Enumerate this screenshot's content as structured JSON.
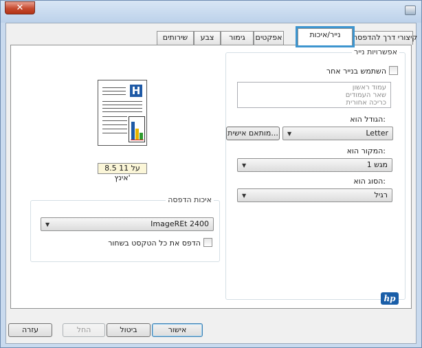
{
  "window": {
    "title": "",
    "close_label": "✕"
  },
  "tabs": [
    {
      "label": "קיצורי דרך להדפסה"
    },
    {
      "label": "נייר/איכות"
    },
    {
      "label": "אפקטים"
    },
    {
      "label": "גימור"
    },
    {
      "label": "צבע"
    },
    {
      "label": "שירותים"
    }
  ],
  "paper_options": {
    "legend": "אפשרויות נייר",
    "use_different_paper": "השתמש בנייר אחר",
    "page_list": [
      "עמוד ראשון",
      "שאר העמודים",
      "כריכה אחורית"
    ],
    "paper_size_label": "הגודל הוא:",
    "paper_size_value": "Letter",
    "custom_button": "מותאם אישית...",
    "paper_source_label": "המקור הוא:",
    "paper_source_value": "מגש 1",
    "paper_type_label": "הסוג הוא:",
    "paper_type_value": "רגיל"
  },
  "preview": {
    "size_caption": "8.5 על 11 אינץ'"
  },
  "print_quality": {
    "legend": "איכות הדפסה",
    "resolution_value": "ImageREt 2400",
    "print_all_text_black": "הדפס את כל הטקסט בשחור"
  },
  "brand": {
    "logo_text": "hp"
  },
  "buttons": {
    "ok": "אישור",
    "cancel": "ביטול",
    "apply": "החל",
    "help": "עזרה"
  },
  "colors": {
    "tab_highlight": "#3d95cf",
    "close_button": "#c64a2f"
  }
}
